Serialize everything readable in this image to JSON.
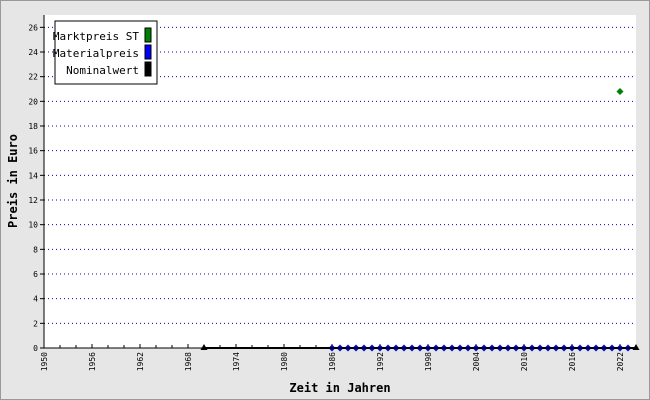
{
  "chart_data": {
    "type": "scatter",
    "xlabel": "Zeit in Jahren",
    "ylabel": "Preis in Euro",
    "xlim": [
      1950,
      2024
    ],
    "ylim": [
      0,
      27
    ],
    "x_ticks": [
      1950,
      1956,
      1962,
      1968,
      1974,
      1980,
      1986,
      1992,
      1998,
      2004,
      2010,
      2016,
      2022
    ],
    "y_ticks": [
      0,
      2,
      4,
      6,
      8,
      10,
      12,
      14,
      16,
      18,
      20,
      22,
      24,
      26
    ],
    "grid": "horizontal dotted",
    "legend_position": "top-left",
    "series": [
      {
        "name": "Marktpreis ST",
        "color": "#008000",
        "marker": "diamond",
        "points": [
          {
            "x": 2022,
            "y": 20.8
          }
        ]
      },
      {
        "name": "Materialpreis",
        "color": "#0000ff",
        "marker": "diamond",
        "points": [
          {
            "x": 1986,
            "y": 0
          },
          {
            "x": 1987,
            "y": 0
          },
          {
            "x": 1988,
            "y": 0
          },
          {
            "x": 1989,
            "y": 0
          },
          {
            "x": 1990,
            "y": 0
          },
          {
            "x": 1991,
            "y": 0
          },
          {
            "x": 1992,
            "y": 0
          },
          {
            "x": 1993,
            "y": 0
          },
          {
            "x": 1994,
            "y": 0
          },
          {
            "x": 1995,
            "y": 0
          },
          {
            "x": 1996,
            "y": 0
          },
          {
            "x": 1997,
            "y": 0
          },
          {
            "x": 1998,
            "y": 0
          },
          {
            "x": 1999,
            "y": 0
          },
          {
            "x": 2000,
            "y": 0
          },
          {
            "x": 2001,
            "y": 0
          },
          {
            "x": 2002,
            "y": 0
          },
          {
            "x": 2003,
            "y": 0
          },
          {
            "x": 2004,
            "y": 0
          },
          {
            "x": 2005,
            "y": 0
          },
          {
            "x": 2006,
            "y": 0
          },
          {
            "x": 2007,
            "y": 0
          },
          {
            "x": 2008,
            "y": 0
          },
          {
            "x": 2009,
            "y": 0
          },
          {
            "x": 2010,
            "y": 0
          },
          {
            "x": 2011,
            "y": 0
          },
          {
            "x": 2012,
            "y": 0
          },
          {
            "x": 2013,
            "y": 0
          },
          {
            "x": 2014,
            "y": 0
          },
          {
            "x": 2015,
            "y": 0
          },
          {
            "x": 2016,
            "y": 0
          },
          {
            "x": 2017,
            "y": 0
          },
          {
            "x": 2018,
            "y": 0
          },
          {
            "x": 2019,
            "y": 0
          },
          {
            "x": 2020,
            "y": 0
          },
          {
            "x": 2021,
            "y": 0
          },
          {
            "x": 2022,
            "y": 0
          },
          {
            "x": 2023,
            "y": 0
          }
        ]
      },
      {
        "name": "Nominalwert",
        "color": "#000000",
        "marker": "triangle",
        "line": true,
        "points": [
          {
            "x": 1970,
            "y": 0
          },
          {
            "x": 2024,
            "y": 0
          }
        ]
      }
    ]
  }
}
